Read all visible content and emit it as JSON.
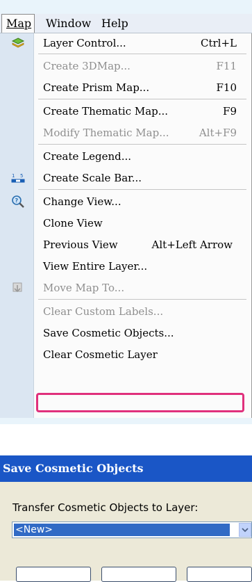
{
  "menubar": {
    "items": [
      "Map",
      "Window",
      "Help"
    ]
  },
  "menu": {
    "items": [
      {
        "label": "Layer Control...",
        "shortcut": "Ctrl+L",
        "enabled": true,
        "icon": "layer-stack-icon"
      },
      {
        "label": "Create 3DMap...",
        "shortcut": "F11",
        "enabled": false
      },
      {
        "label": "Create Prism Map...",
        "shortcut": "F10",
        "enabled": true
      },
      {
        "label": "Create Thematic Map...",
        "shortcut": "F9",
        "enabled": true
      },
      {
        "label": "Modify Thematic Map...",
        "shortcut": "Alt+F9",
        "enabled": false
      },
      {
        "label": "Create Legend...",
        "shortcut": "",
        "enabled": true
      },
      {
        "label": "Create Scale Bar...",
        "shortcut": "",
        "enabled": true,
        "icon": "scale-bar-icon"
      },
      {
        "label": "Change View...",
        "shortcut": "",
        "enabled": true,
        "icon": "magnifier-icon"
      },
      {
        "label": "Clone View",
        "shortcut": "",
        "enabled": true
      },
      {
        "label": "Previous View",
        "shortcut": "Alt+Left Arrow",
        "enabled": true
      },
      {
        "label": "View Entire Layer...",
        "shortcut": "",
        "enabled": true
      },
      {
        "label": "Move Map To...",
        "shortcut": "",
        "enabled": false,
        "icon": "move-map-icon"
      },
      {
        "label": "Clear Custom Labels...",
        "shortcut": "",
        "enabled": false
      },
      {
        "label": "Save Cosmetic Objects...",
        "shortcut": "",
        "enabled": true,
        "highlighted": true
      },
      {
        "label": "Clear Cosmetic Layer",
        "shortcut": "",
        "enabled": true
      }
    ]
  },
  "dialog": {
    "title": "Save Cosmetic Objects",
    "field_label": "Transfer Cosmetic Objects to Layer:",
    "selected_value": "<New>"
  },
  "colors": {
    "highlight": "#e0307c",
    "title_bar": "#1a56c6",
    "selection": "#316ac5"
  }
}
